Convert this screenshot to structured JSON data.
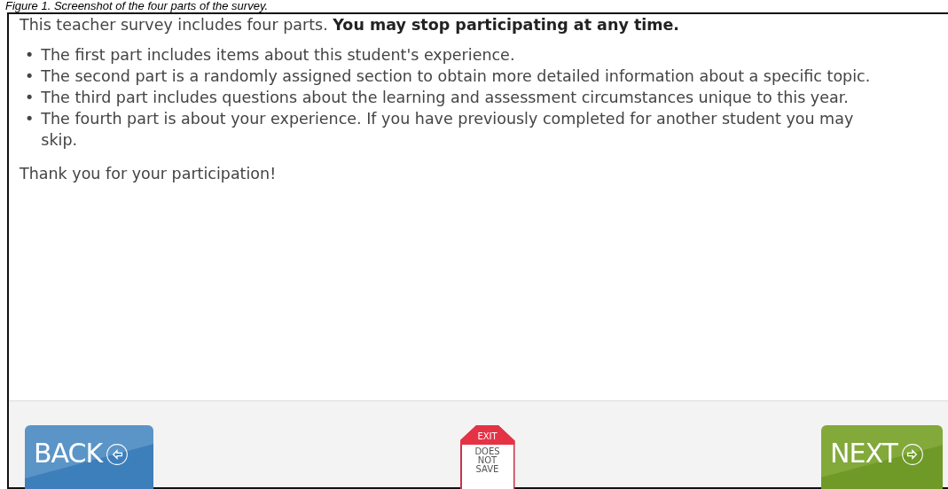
{
  "caption": "Figure 1. Screenshot of the four parts of the survey.",
  "intro": "This teacher survey includes four parts. **You may stop participating at any time.**",
  "bullets": [
    {
      "marker": "•",
      "text": "The first part includes items about this student's experience."
    },
    {
      "marker": "•",
      "text": "The second part is a randomly assigned section to obtain more detailed information about a specific topic."
    },
    {
      "marker": "•",
      "text": "The third part includes questions about the learning and assessment circumstances unique to this year."
    },
    {
      "marker": "•",
      "text": "The fourth part is about your experience. If you have previously completed for another student you may skip."
    }
  ],
  "thanks": "Thank you for your participation!",
  "footer": {
    "back": {
      "label": "BACK"
    },
    "exit": {
      "top": "EXIT",
      "lines": [
        "DOES",
        "NOT",
        "SAVE"
      ]
    },
    "next": {
      "label": "NEXT"
    }
  }
}
